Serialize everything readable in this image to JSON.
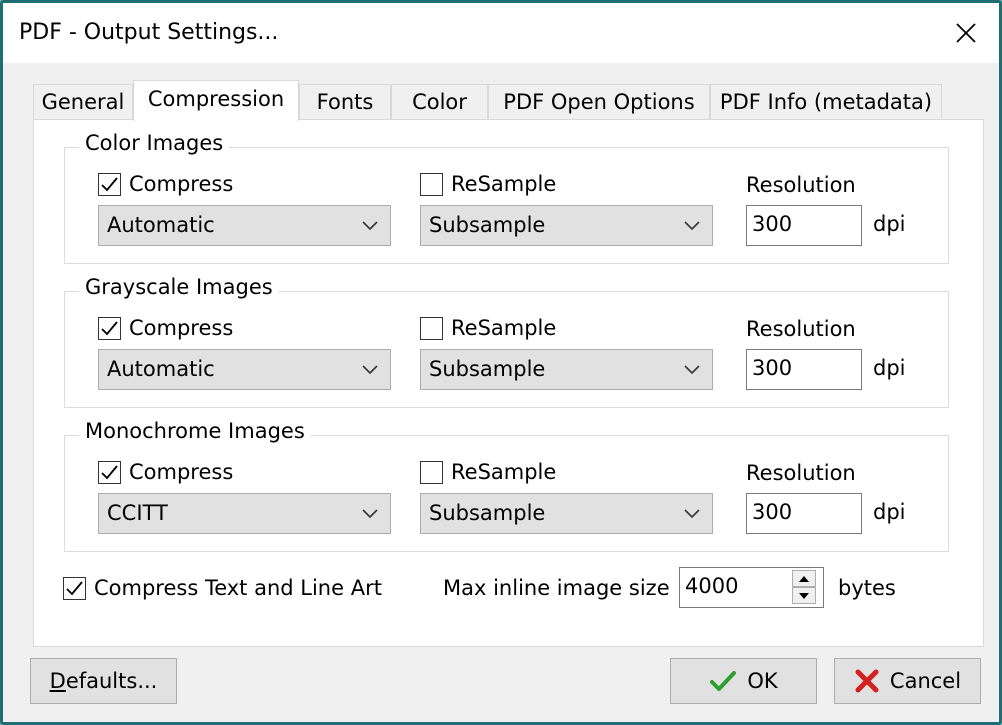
{
  "window": {
    "title": "PDF - Output Settings..."
  },
  "tabs": [
    {
      "label": "General"
    },
    {
      "label": "Compression"
    },
    {
      "label": "Fonts"
    },
    {
      "label": "Color"
    },
    {
      "label": "PDF Open Options"
    },
    {
      "label": "PDF Info (metadata)"
    }
  ],
  "active_tab": "Compression",
  "groups": [
    {
      "title": "Color Images",
      "compress_label": "Compress",
      "compress_checked": true,
      "method": "Automatic",
      "resample_label": "ReSample",
      "resample_checked": false,
      "resample_method": "Subsample",
      "resolution_label": "Resolution",
      "resolution": "300",
      "unit": "dpi"
    },
    {
      "title": "Grayscale Images",
      "compress_label": "Compress",
      "compress_checked": true,
      "method": "Automatic",
      "resample_label": "ReSample",
      "resample_checked": false,
      "resample_method": "Subsample",
      "resolution_label": "Resolution",
      "resolution": "300",
      "unit": "dpi"
    },
    {
      "title": "Monochrome Images",
      "compress_label": "Compress",
      "compress_checked": true,
      "method": "CCITT",
      "resample_label": "ReSample",
      "resample_checked": false,
      "resample_method": "Subsample",
      "resolution_label": "Resolution",
      "resolution": "300",
      "unit": "dpi"
    }
  ],
  "compress_text": {
    "label": "Compress Text and Line Art",
    "checked": true
  },
  "max_inline": {
    "label": "Max inline image size",
    "value": "4000",
    "unit": "bytes"
  },
  "buttons": {
    "defaults_prefix": "D",
    "defaults_rest": "efaults...",
    "ok": "OK",
    "cancel": "Cancel"
  },
  "colors": {
    "ok_check": "#2e9e2e",
    "cancel_x": "#d42020",
    "frame": "#1f6e76"
  }
}
